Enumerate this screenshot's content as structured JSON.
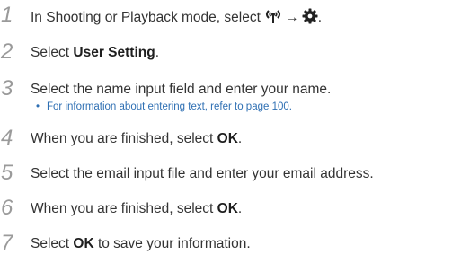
{
  "steps": [
    {
      "number": "1",
      "before": "In Shooting or Playback mode, select ",
      "arrow": "→",
      "after": ".",
      "icons": [
        "wifi-signal-icon",
        "settings-gear-icon"
      ]
    },
    {
      "number": "2",
      "before": "Select ",
      "bold": "User Setting",
      "after": "."
    },
    {
      "number": "3",
      "text": "Select the name input field and enter your name.",
      "note_bullet": "•",
      "note": "For information about entering text, refer to page 100."
    },
    {
      "number": "4",
      "before": "When you are finished, select ",
      "bold": "OK",
      "after": "."
    },
    {
      "number": "5",
      "text": "Select the email input file and enter your email address."
    },
    {
      "number": "6",
      "before": "When you are finished, select ",
      "bold": "OK",
      "after": "."
    },
    {
      "number": "7",
      "before": "Select ",
      "bold": "OK",
      "after": " to save your information."
    }
  ],
  "colors": {
    "number": "#9a9a9a",
    "text": "#333333",
    "note": "#2e6fb3"
  }
}
